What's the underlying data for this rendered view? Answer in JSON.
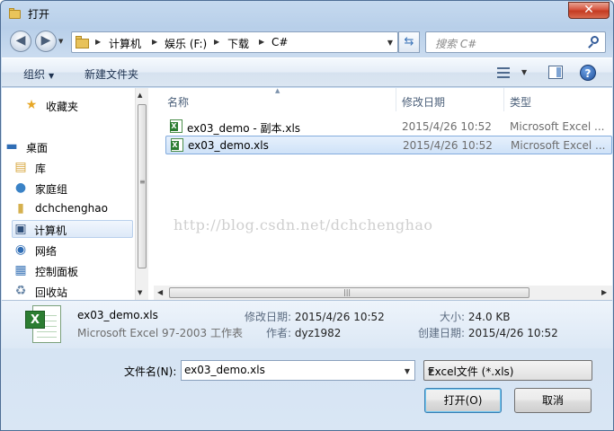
{
  "window": {
    "title": "打开",
    "close_glyph": "✕"
  },
  "nav": {
    "back_glyph": "◀",
    "forward_glyph": "▶",
    "breadcrumb": [
      "计算机",
      "娱乐 (F:)",
      "下载",
      "C#"
    ],
    "search_placeholder": "搜索 C#"
  },
  "toolbar": {
    "organize": "组织",
    "new_folder": "新建文件夹",
    "help": "?"
  },
  "sidebar": {
    "items": [
      {
        "label": "收藏夹",
        "icon": "star-icon"
      },
      {
        "label": "桌面",
        "icon": "desktop-icon"
      },
      {
        "label": "库",
        "icon": "library-icon"
      },
      {
        "label": "家庭组",
        "icon": "homegroup-icon"
      },
      {
        "label": "dchchenghao",
        "icon": "user-icon"
      },
      {
        "label": "计算机",
        "icon": "computer-icon"
      },
      {
        "label": "网络",
        "icon": "network-icon"
      },
      {
        "label": "控制面板",
        "icon": "control-panel-icon"
      },
      {
        "label": "回收站",
        "icon": "recycle-bin-icon"
      }
    ],
    "selected": "计算机"
  },
  "columns": {
    "name": "名称",
    "modified": "修改日期",
    "type": "类型"
  },
  "files": [
    {
      "name": "ex03_demo - 副本.xls",
      "modified": "2015/4/26 10:52",
      "type": "Microsoft Excel ..."
    },
    {
      "name": "ex03_demo.xls",
      "modified": "2015/4/26 10:52",
      "type": "Microsoft Excel ..."
    }
  ],
  "watermark": "http://blog.csdn.net/dchchenghao",
  "details": {
    "name": "ex03_demo.xls",
    "type": "Microsoft Excel 97-2003 工作表",
    "modified_label": "修改日期:",
    "modified_value": "2015/4/26 10:52",
    "author_label": "作者:",
    "author_value": "dyz1982",
    "size_label": "大小:",
    "size_value": "24.0 KB",
    "created_label": "创建日期:",
    "created_value": "2015/4/26 10:52"
  },
  "form": {
    "filename_label": "文件名(N):",
    "filename_value": "ex03_demo.xls",
    "filetype": "Excel文件 (*.xls)",
    "open": "打开(O)",
    "cancel": "取消"
  }
}
